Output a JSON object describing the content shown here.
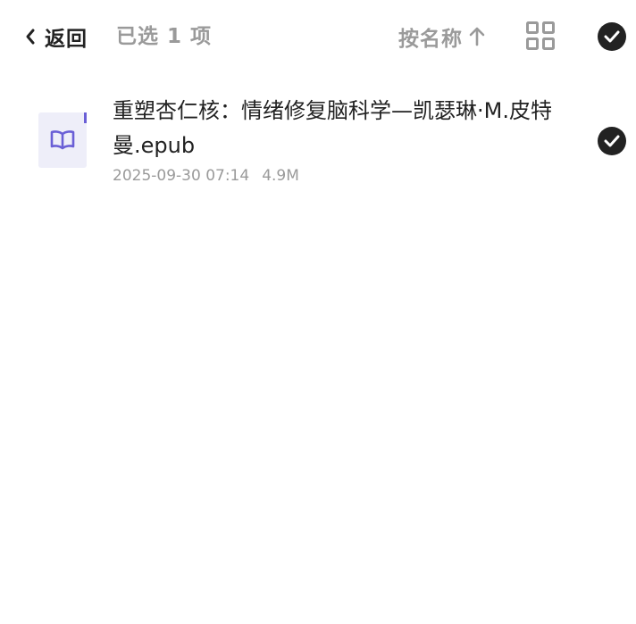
{
  "header": {
    "back_label": "返回",
    "selected_text": "已选 1 项",
    "sort_label": "按名称",
    "icons": {
      "back": "chevron-left-icon",
      "sort": "arrow-up-icon",
      "view": "grid-view-icon",
      "select_all": "check-circle-icon"
    }
  },
  "files": [
    {
      "name": "重塑杏仁核：情绪修复脑科学—凯瑟琳·M.皮特曼.epub",
      "date": "2025-09-30 07:14",
      "size": "4.9M",
      "icon": "book-icon",
      "selected": true
    }
  ],
  "colors": {
    "accent": "#6a5fd6",
    "thumb_bg": "#eeeef9",
    "text_primary": "#222222",
    "text_secondary": "#9a9a9a",
    "check_bg": "#222222"
  }
}
